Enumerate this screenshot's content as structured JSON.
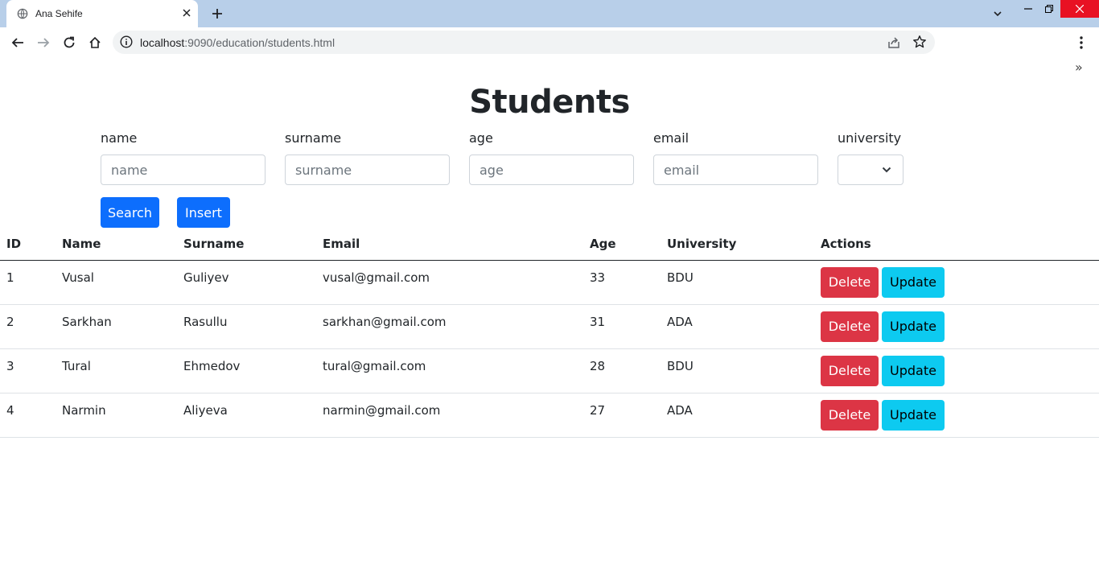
{
  "browser": {
    "tab_title": "Ana Sehife",
    "url_host": "localhost",
    "url_rest": ":9090/education/students.html",
    "bookmarks_more": "»"
  },
  "page": {
    "title": "Students"
  },
  "filters": [
    {
      "label": "name",
      "placeholder": "name"
    },
    {
      "label": "surname",
      "placeholder": "surname"
    },
    {
      "label": "age",
      "placeholder": "age"
    },
    {
      "label": "email",
      "placeholder": "email"
    }
  ],
  "university_filter": {
    "label": "university",
    "selected": ""
  },
  "buttons": {
    "search": "Search",
    "insert": "Insert",
    "delete": "Delete",
    "update": "Update"
  },
  "table": {
    "headers": [
      "ID",
      "Name",
      "Surname",
      "Email",
      "Age",
      "University",
      "Actions"
    ],
    "rows": [
      {
        "id": "1",
        "name": "Vusal",
        "surname": "Guliyev",
        "email": "vusal@gmail.com",
        "age": "33",
        "university": "BDU"
      },
      {
        "id": "2",
        "name": "Sarkhan",
        "surname": "Rasullu",
        "email": "sarkhan@gmail.com",
        "age": "31",
        "university": "ADA"
      },
      {
        "id": "3",
        "name": "Tural",
        "surname": "Ehmedov",
        "email": "tural@gmail.com",
        "age": "28",
        "university": "BDU"
      },
      {
        "id": "4",
        "name": "Narmin",
        "surname": "Aliyeva",
        "email": "narmin@gmail.com",
        "age": "27",
        "university": "ADA"
      }
    ]
  },
  "colors": {
    "primary": "#0d6efd",
    "danger": "#dc3545",
    "info": "#0dcaf0",
    "tabstrip": "#b8cfe9"
  }
}
